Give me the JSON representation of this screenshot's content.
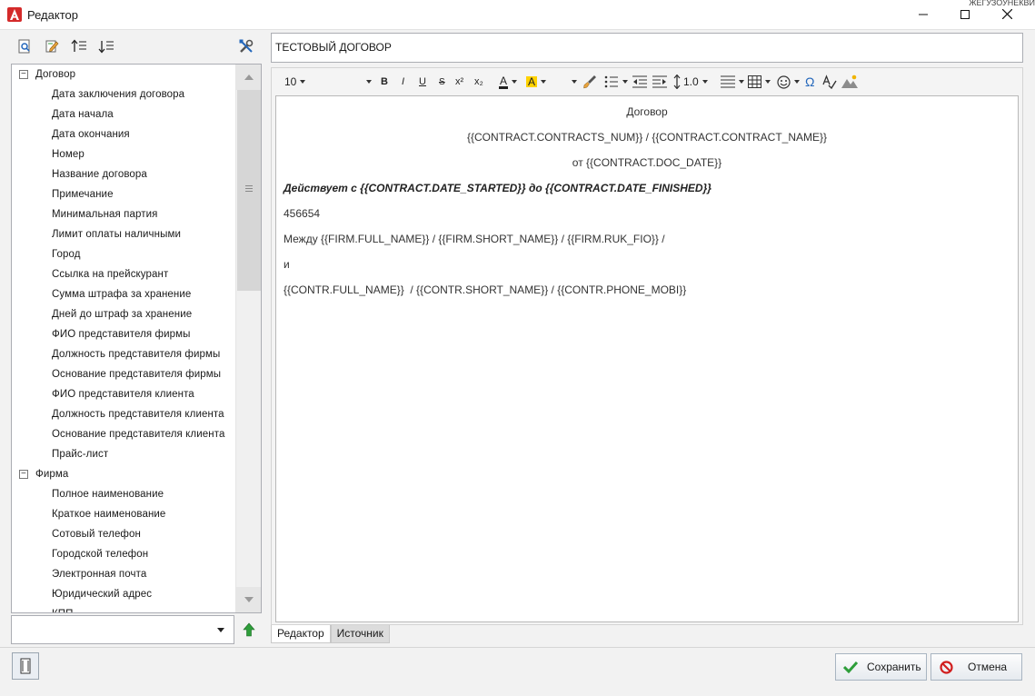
{
  "window": {
    "title": "Редактор",
    "corner_fragment": "ЖЕГУЗОУНЕКВИ"
  },
  "sidebar": {
    "tree": [
      {
        "label": "Договор",
        "expanded": true,
        "children": [
          "Дата заключения договора",
          "Дата начала",
          "Дата окончания",
          "Номер",
          "Название договора",
          "Примечание",
          "Минимальная партия",
          "Лимит оплаты наличными",
          "Город",
          "Ссылка на прейскурант",
          "Сумма штрафа за хранение",
          "Дней до штраф за хранение",
          "ФИО представителя фирмы",
          "Должность представителя фирмы",
          "Основание представителя фирмы",
          "ФИО представителя клиента",
          "Должность представителя клиента",
          "Основание представителя клиента",
          "Прайс-лист"
        ]
      },
      {
        "label": "Фирма",
        "expanded": true,
        "children": [
          "Полное наименование",
          "Краткое наименование",
          "Сотовый телефон",
          "Городской телефон",
          "Электронная почта",
          "Юридический адрес",
          "КПП"
        ]
      }
    ],
    "field_select": {
      "value": ""
    }
  },
  "document": {
    "title_value": "ТЕСТОВЫЙ ДОГОВОР",
    "lines": [
      "Договор",
      "{{CONTRACT.CONTRACTS_NUM}} / {{CONTRACT.CONTRACT_NAME}}",
      "от {{CONTRACT.DOC_DATE}}",
      "Действует с {{CONTRACT.DATE_STARTED}} до {{CONTRACT.DATE_FINISHED}}",
      "456654",
      "Между {{FIRM.FULL_NAME}} / {{FIRM.SHORT_NAME}} / {{FIRM.RUK_FIO}} /",
      "и",
      "{{CONTR.FULL_NAME}}  / {{CONTR.SHORT_NAME}} / {{CONTR.PHONE_MOBI}}"
    ]
  },
  "editor_toolbar": {
    "font_size": "10",
    "bold": "B",
    "italic": "I",
    "underline": "U",
    "strike": "S",
    "superscript": "x²",
    "subscript": "x₂",
    "font_color": "A",
    "highlight": "A",
    "line_spacing": "1.0",
    "omega": "Ω"
  },
  "tabs": {
    "editor": "Редактор",
    "source": "Источник"
  },
  "buttons": {
    "save": "Сохранить",
    "cancel": "Отмена"
  },
  "colors": {
    "accent_red": "#d42a2a",
    "save_green": "#2e9e3a",
    "cancel_red": "#d11f1f",
    "highlight_yellow": "#ffd200",
    "icon_blue": "#2266bb"
  }
}
